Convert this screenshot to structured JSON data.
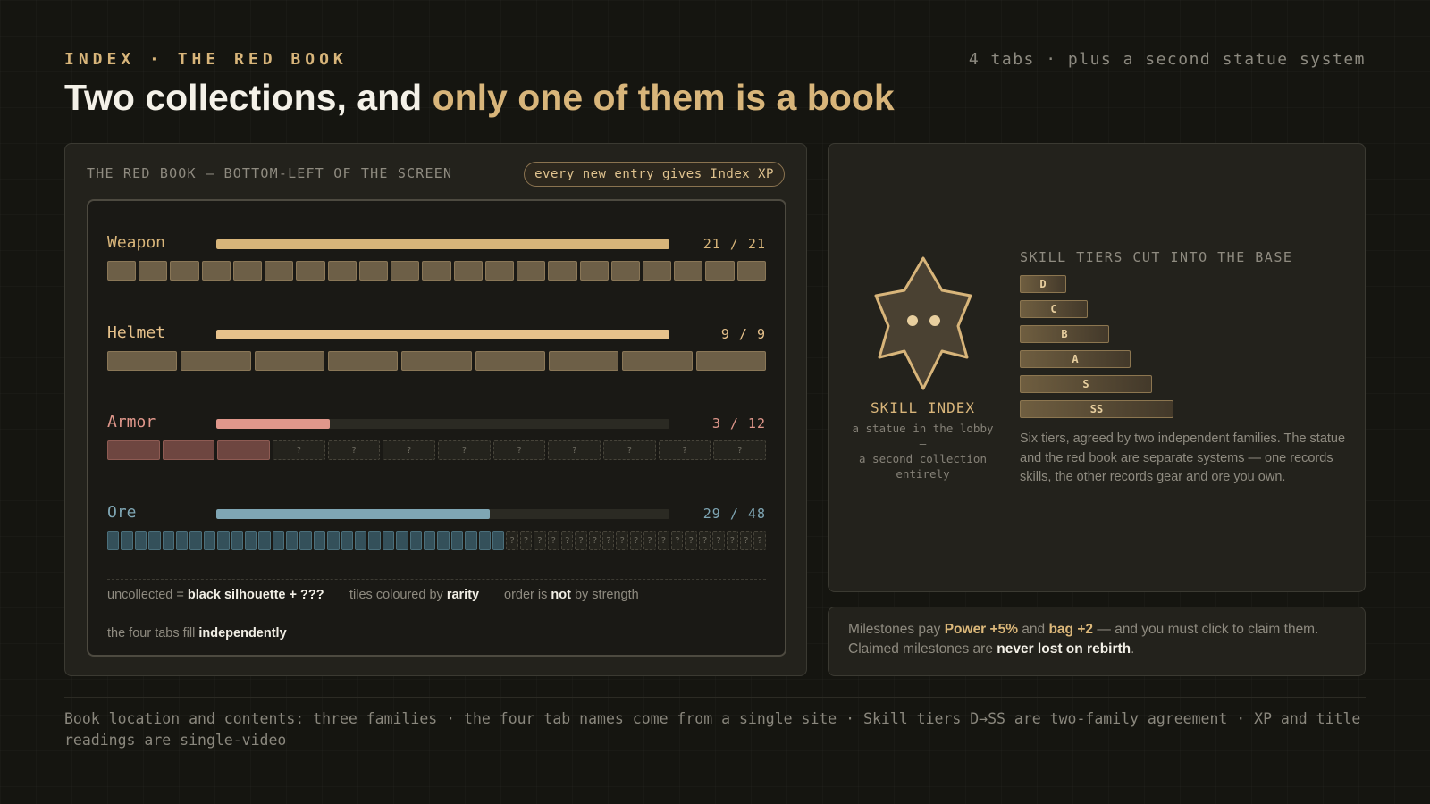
{
  "header": {
    "eyebrow": "INDEX · THE RED BOOK",
    "top_note": "4 tabs · plus a second statue system",
    "title_plain": "Two collections, and ",
    "title_accent": "only one of them is a book"
  },
  "red_book": {
    "label": "THE RED BOOK — BOTTOM-LEFT OF THE SCREEN",
    "pill": "every new entry gives Index XP",
    "tabs": [
      {
        "name": "Weapon",
        "count_text": "21 / 21",
        "collected": 21,
        "total": 21,
        "color": "#d8b57a",
        "tile_color": "#6d5f47",
        "tile_border": "#8a7757"
      },
      {
        "name": "Helmet",
        "count_text": "9 / 9",
        "collected": 9,
        "total": 9,
        "color": "#e6c18b",
        "tile_color": "#6d5f47",
        "tile_border": "#8a7757"
      },
      {
        "name": "Armor",
        "count_text": "3 / 12",
        "collected": 3,
        "total": 12,
        "color": "#e0978b",
        "tile_color": "#6e4640",
        "tile_border": "#8e5b53"
      },
      {
        "name": "Ore",
        "count_text": "29 / 48",
        "collected": 29,
        "total": 48,
        "color": "#7fa6b4",
        "tile_color": "#34505a",
        "tile_border": "#4b6f7b"
      }
    ],
    "unknown_glyph": "?",
    "legend": {
      "uncollected_prefix": "uncollected = ",
      "uncollected_bold": "black silhouette + ???",
      "tiles_prefix": "tiles coloured by ",
      "tiles_bold": "rarity",
      "order_prefix": "order is ",
      "order_bold": "not",
      "order_suffix": " by strength",
      "tabs_prefix": "the four tabs fill ",
      "tabs_bold": "independently"
    }
  },
  "skill_index": {
    "title": "SKILL INDEX",
    "sub_line1": "a statue in the lobby",
    "sub_line2": "—",
    "sub_line3": "a second collection",
    "sub_line4": "entirely",
    "tiers_label": "SKILL TIERS CUT INTO THE BASE",
    "tiers": [
      "D",
      "C",
      "B",
      "A",
      "S",
      "SS"
    ],
    "description": "Six tiers, agreed by two independent families. The statue and the red book are separate systems — one records skills, the other records gear and ore you own."
  },
  "milestones": {
    "p1": "Milestones pay ",
    "power": "Power +5%",
    "p2": " and ",
    "bag": "bag +2",
    "p3": " — and you must click to claim them. Claimed milestones are ",
    "never_lost": "never lost on rebirth",
    "p4": "."
  },
  "footer": {
    "text": "Book location and contents: three families · the four tab names come from a single site · Skill tiers D→SS are two-family agreement · XP and title readings are single-video"
  },
  "colors": {
    "accent": "#d8b57a",
    "background": "#151510",
    "panel": "#23221c",
    "statue_fill": "#4a4132",
    "statue_stroke": "#d8b57a"
  }
}
